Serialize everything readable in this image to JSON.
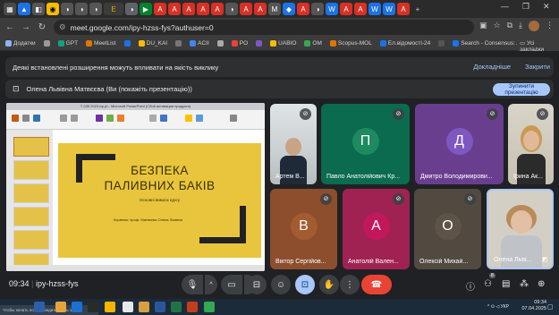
{
  "browser": {
    "url": "meet.google.com/ipy-hzss-fys?authuser=0",
    "tab_icons": [
      "drive-icon",
      "youtube-icon",
      "chrome-icon",
      "pdf-icon",
      "meet-icon"
    ],
    "bookmarks": [
      "Додатки",
      "GPT",
      "MeetList",
      "DU_KAI",
      "ACII",
      "PO",
      "UABIO",
      "OM",
      "Scopus-MOL",
      "Ел.відомості-24",
      "Search - Consensus: AI S..."
    ],
    "all_bookmarks": "Усі закладки"
  },
  "meet": {
    "banner_text": "Деякі встановлені розширення можуть впливати на якість виклику",
    "banner_details": "Докладніше",
    "banner_close": "Закрити",
    "presenter_text": "Олена Львівна Матвєєва (Ви (покажіть презентацію))",
    "stop_button": "Зупинити презентацію",
    "meeting_time": "09:34",
    "meeting_code": "ipy-hzss-fys",
    "participant_count": "8"
  },
  "presentation": {
    "window_title": "Т-035 2023-bp.pt - Microsoft PowerPoint (Сбой активации продукта)",
    "slide_title_line1": "БЕЗПЕКА",
    "slide_title_line2": "ПАЛИВНИХ БАКІВ",
    "slide_subtitle": "Основні вимоги курсу",
    "slide_author": "Керівник: проф. Матвеєва Олена Львівна"
  },
  "participants": [
    {
      "name": "Артем В...",
      "avatar_letter": "",
      "bg": "#cfd5d7",
      "muted": true
    },
    {
      "name": "Павло Анатолійович Кр...",
      "avatar_letter": "П",
      "bg": "#0b6b4f",
      "avatar_color": "#1e8a5f",
      "muted": true
    },
    {
      "name": "Дмитро Володимирови...",
      "avatar_letter": "Д",
      "bg": "#6a3e8f",
      "avatar_color": "#7e57c2",
      "muted": true
    },
    {
      "name": "Ірина Ак...",
      "avatar_letter": "",
      "bg": "#c9bba0",
      "muted": true
    },
    {
      "name": "Віктор Сергійов...",
      "avatar_letter": "В",
      "bg": "#8d4e2e",
      "avatar_color": "#a35b30",
      "muted": true
    },
    {
      "name": "Анатолій Вален...",
      "avatar_letter": "А",
      "bg": "#a02252",
      "avatar_color": "#c2185b",
      "muted": true
    },
    {
      "name": "Олексій Михай...",
      "avatar_letter": "О",
      "bg": "#514a40",
      "avatar_color": "#5d5447",
      "muted": true
    },
    {
      "name": "Олена Льві...",
      "avatar_letter": "",
      "bg": "#d4cfc4",
      "muted": false
    }
  ],
  "taskbar": {
    "search_placeholder": "Чтобы начать поиск, введите здесь запрос",
    "clock_time": "09:34",
    "clock_date": "07.04.2025",
    "lang": "УКР"
  },
  "colors": {
    "accent_blue": "#a8c7fa",
    "end_call_red": "#ea4335",
    "slide_yellow": "#e8c53c"
  }
}
